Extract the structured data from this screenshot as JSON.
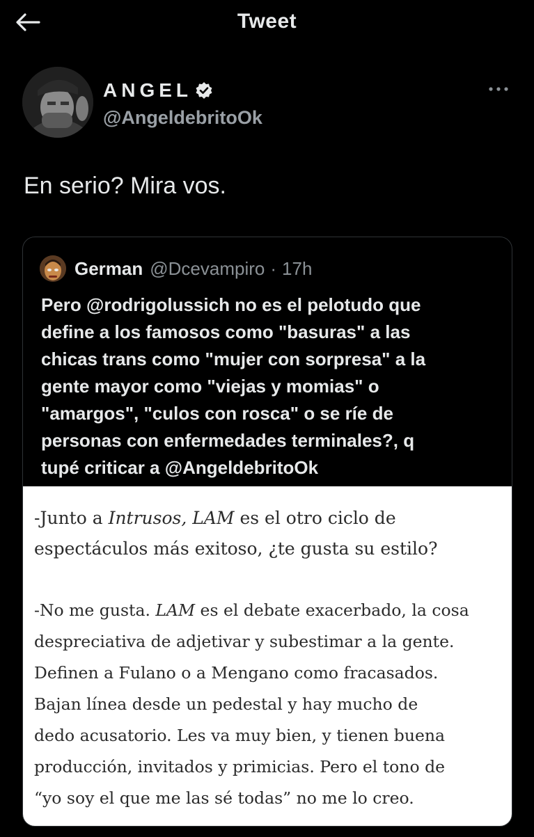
{
  "topbar": {
    "title": "Tweet",
    "back_icon": "arrow-left-icon"
  },
  "tweet": {
    "author": {
      "display_name": "ANGEL",
      "handle": "@AngeldebritoOk",
      "verified": true
    },
    "text": "En serio? Mira vos."
  },
  "quote": {
    "author": {
      "name": "German",
      "handle": "@Dcevampiro",
      "separator": "·",
      "time": "17h"
    },
    "lines": [
      "Pero @rodrigolussich no es el pelotudo que",
      "define a los famosos como \"basuras\" a las",
      "chicas trans como \"mujer con sorpresa\" a la",
      "gente mayor como \"viejas y momias\" o",
      "\"amargos\", \"culos con rosca\" o se ríe de",
      "personas con enfermedades terminales?, q",
      "tupé criticar a @AngeldebritoOk"
    ],
    "image_text": {
      "question": {
        "l1_a": "-Junto a ",
        "l1_b": "Intrusos, LAM",
        "l1_c": " es el otro ciclo de",
        "l2": "espectáculos más exitoso, ¿te gusta su estilo?"
      },
      "answer": {
        "l1_a": "-No me gusta. ",
        "l1_b": "LAM",
        "l1_c": " es el debate exacerbado, la cosa",
        "l2": "despreciativa de adjetivar y subestimar a la gente.",
        "l3": "Definen a Fulano o a Mengano como fracasados.",
        "l4": "Bajan línea desde un pedestal y hay mucho de",
        "l5": "dedo acusatorio. Les va muy bien, y tienen buena",
        "l6": "producción, invitados y primicias. Pero el tono de",
        "l7": "“yo soy el que me las sé todas” no me lo creo."
      }
    }
  },
  "colors": {
    "background": "#000000",
    "text_primary": "#e7e9ea",
    "text_secondary": "#8b9196",
    "border": "#2f3336",
    "image_bg": "#ffffff"
  }
}
